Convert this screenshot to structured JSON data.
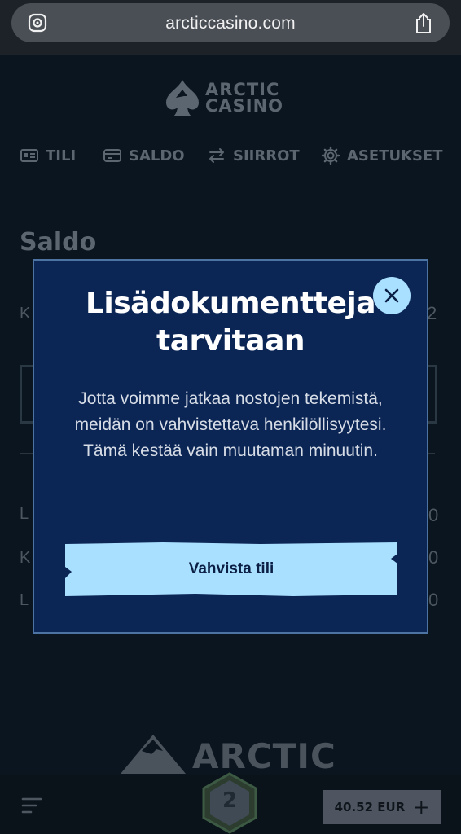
{
  "browser": {
    "url": "arcticcasino.com"
  },
  "brand": {
    "line1": "ARCTIC",
    "line2": "CASINO",
    "footer_word": "ARCTIC"
  },
  "nav": [
    {
      "label": "TILI",
      "icon": "id-card-icon"
    },
    {
      "label": "SALDO",
      "icon": "wallet-icon"
    },
    {
      "label": "SIIRROT",
      "icon": "transfer-icon"
    },
    {
      "label": "ASETUKSET",
      "icon": "gear-icon"
    }
  ],
  "background": {
    "title": "Saldo",
    "row_letters": [
      "K",
      "L",
      "K",
      "L"
    ],
    "right_digits": [
      "2",
      "0",
      "0",
      "0"
    ]
  },
  "modal": {
    "title": "Lisädokumentteja tarvitaan",
    "body": "Jotta voimme jatkaa nostojen tekemistä, meidän on vahvistettava henkilöllisyytesi. Tämä kestää vain muutaman minuutin.",
    "button_label": "Vahvista tili",
    "close_icon": "close-icon",
    "colors": {
      "background": "#0b2555",
      "border": "#4d73a3",
      "button": "#a9dfff"
    }
  },
  "bottom_bar": {
    "level": "2",
    "balance": "40.52 EUR",
    "plus": "+"
  }
}
